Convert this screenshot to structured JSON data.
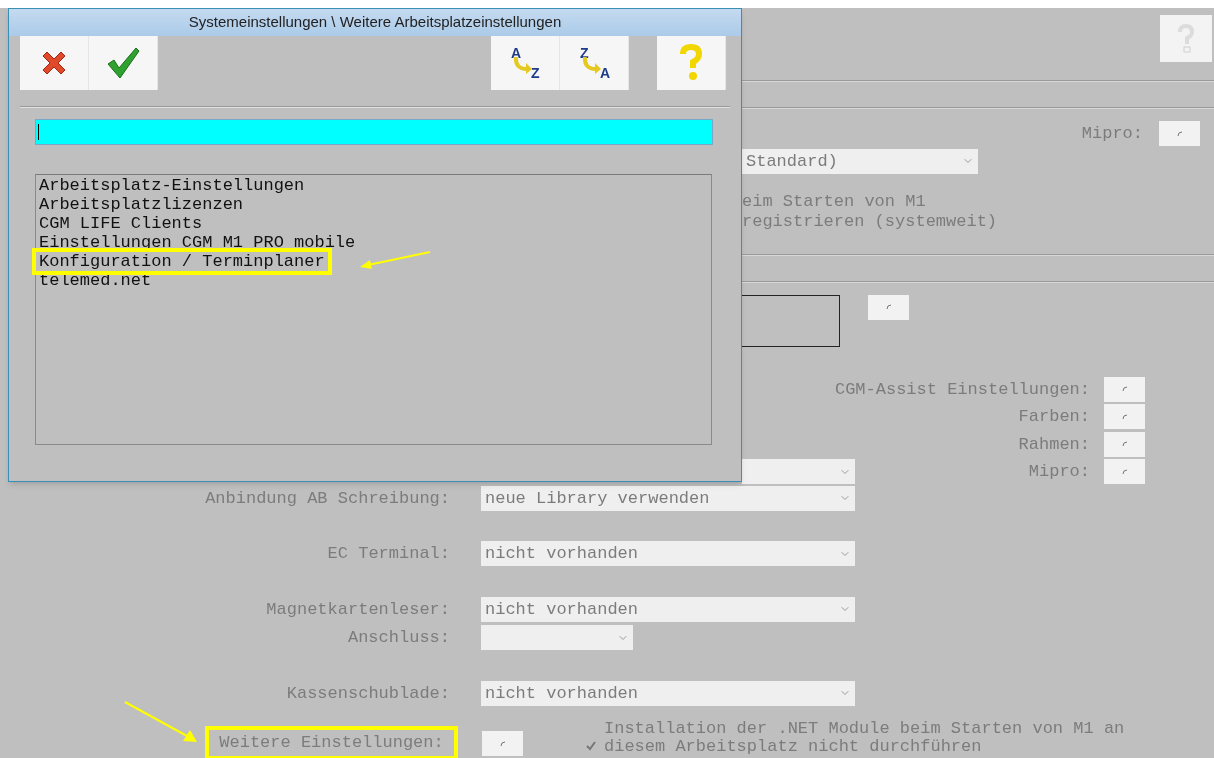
{
  "dialog": {
    "title": "Systemeinstellungen \\ Weitere Arbeitsplatzeinstellungen",
    "toolbar": [
      {
        "kind": "cancel"
      },
      {
        "kind": "confirm"
      },
      {
        "kind": "sort",
        "from": "A",
        "to": "Z"
      },
      {
        "kind": "sort",
        "from": "Z",
        "to": "A"
      },
      {
        "kind": "help"
      }
    ],
    "search": {
      "focused": true
    },
    "items": [
      {
        "label": "Arbeitsplatz-Einstellungen",
        "annotated": false
      },
      {
        "label": "Arbeitsplatzlizenzen",
        "annotated": false
      },
      {
        "label": "CGM LIFE Clients",
        "annotated": false
      },
      {
        "label": "Einstellungen CGM M1 PRO mobile",
        "annotated": false
      },
      {
        "label": "Konfiguration / Terminplaner",
        "annotated": true
      },
      {
        "label": "telemed.net",
        "annotated": false
      }
    ]
  },
  "main": {
    "help_button": {
      "disabled": true
    },
    "mipro": {
      "label": "Mipro:",
      "selected": false
    },
    "frame_radio": {
      "selected": false
    },
    "mode_select": {
      "value": "Standard)"
    },
    "startup_lines": [
      "eim Starten von M1",
      "registrieren (systemweit)"
    ],
    "radio_options": [
      {
        "label": "CGM-Assist Einstellungen:",
        "selected": false
      },
      {
        "label": "Farben:",
        "selected": false
      },
      {
        "label": "Rahmen:",
        "selected": false
      },
      {
        "label": "Mipro:",
        "selected": false
      }
    ],
    "device_rows": [
      {
        "label": "Anbindung AB Schreibung:",
        "value": "neue Library verwenden",
        "kind": "wide"
      },
      {
        "label": "EC Terminal:",
        "value": "nicht vorhanden",
        "kind": "wide"
      },
      {
        "label": "Magnetkartenleser:",
        "value": "nicht vorhanden",
        "kind": "wide"
      },
      {
        "label": "Anschluss:",
        "kind": "narrow"
      },
      {
        "label": "Kassenschublade:",
        "value": "nicht vorhanden",
        "kind": "wide"
      }
    ],
    "more_settings": {
      "label": "Weitere Einstellungen:",
      "annotated": true,
      "selected": false
    },
    "net_option": {
      "checked": true,
      "label": "Installation der .NET Module beim Starten von M1 an diesem Arbeitsplatz nicht durchführen"
    }
  }
}
